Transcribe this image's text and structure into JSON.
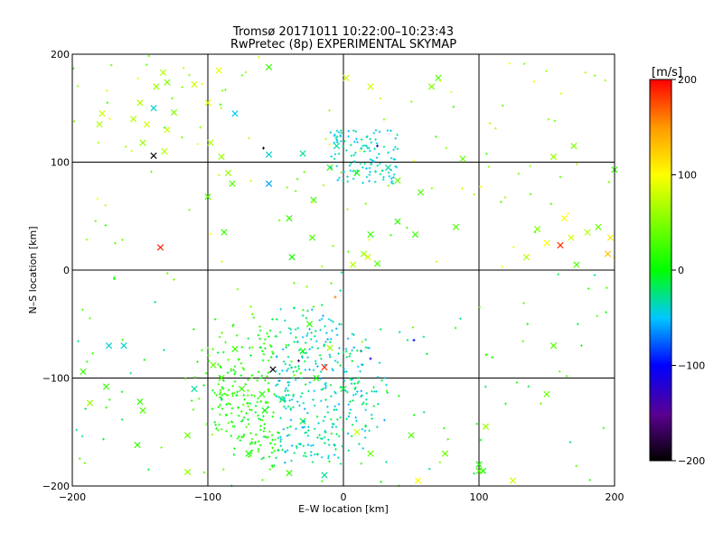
{
  "chart_data": {
    "type": "scatter",
    "title": "Tromsø 20171011 10:22:00–10:23:43",
    "subtitle": "RwPretec (8p) EXPERIMENTAL SKYMAP",
    "xlabel": "E–W location [km]",
    "ylabel": "N–S location [km]",
    "xlim": [
      -200,
      200
    ],
    "ylim": [
      -200,
      200
    ],
    "x_ticks": [
      "−200",
      "−100",
      "0",
      "100",
      "200"
    ],
    "y_ticks": [
      "−200",
      "−100",
      "0",
      "100",
      "200"
    ],
    "grid": true,
    "colorbar": {
      "label": "[m/s]",
      "range": [
        -200,
        200
      ],
      "ticks": [
        "200",
        "100",
        "0",
        "−100",
        "−200"
      ]
    },
    "marker_legend": "x = large marker, + = small marker",
    "points": [
      {
        "x": -140,
        "y": 106,
        "v": -200,
        "m": "x"
      },
      {
        "x": -135,
        "y": 21,
        "v": 190,
        "m": "x"
      },
      {
        "x": -52,
        "y": -92,
        "v": -200,
        "m": "x"
      },
      {
        "x": -14,
        "y": -90,
        "v": 190,
        "m": "x"
      },
      {
        "x": 160,
        "y": 23,
        "v": 185,
        "m": "x"
      },
      {
        "x": -59,
        "y": 113,
        "v": -200,
        "m": "+"
      },
      {
        "x": -33,
        "y": -84,
        "v": -170,
        "m": "+"
      },
      {
        "x": -6,
        "y": -25,
        "v": 160,
        "m": "+"
      },
      {
        "x": 20,
        "y": -82,
        "v": -110,
        "m": "+"
      },
      {
        "x": 52,
        "y": -65,
        "v": -100,
        "m": "+"
      },
      {
        "x": 13,
        "y": -75,
        "v": -110,
        "m": "+"
      },
      {
        "x": 25,
        "y": 115,
        "v": -110,
        "m": "+"
      },
      {
        "x": -55,
        "y": 80,
        "v": -60,
        "m": "x"
      },
      {
        "x": -80,
        "y": 145,
        "v": -50,
        "m": "x"
      },
      {
        "x": -140,
        "y": 150,
        "v": -40,
        "m": "x"
      },
      {
        "x": -173,
        "y": -70,
        "v": -40,
        "m": "x"
      },
      {
        "x": -162,
        "y": -70,
        "v": -40,
        "m": "x"
      },
      {
        "x": -110,
        "y": -110,
        "v": -30,
        "m": "x"
      },
      {
        "x": -14,
        "y": -190,
        "v": -30,
        "m": "x"
      },
      {
        "x": -55,
        "y": 107,
        "v": -40,
        "m": "x"
      },
      {
        "x": -30,
        "y": 108,
        "v": -30,
        "m": "x"
      },
      {
        "x": -5,
        "y": 115,
        "v": -30,
        "m": "x"
      },
      {
        "x": 33,
        "y": 95,
        "v": -30,
        "m": "x"
      },
      {
        "x": 100,
        "y": -180,
        "v": 10,
        "m": "x"
      },
      {
        "x": 103,
        "y": -186,
        "v": 10,
        "m": "x"
      },
      {
        "x": 105,
        "y": -145,
        "v": 60,
        "m": "x"
      },
      {
        "x": 88,
        "y": 103,
        "v": 40,
        "m": "x"
      },
      {
        "x": 70,
        "y": 178,
        "v": 30,
        "m": "x"
      },
      {
        "x": 65,
        "y": 170,
        "v": 50,
        "m": "x"
      },
      {
        "x": -55,
        "y": 188,
        "v": 20,
        "m": "x"
      },
      {
        "x": -92,
        "y": 185,
        "v": 90,
        "m": "x"
      },
      {
        "x": -98,
        "y": 118,
        "v": 70,
        "m": "x"
      },
      {
        "x": -90,
        "y": 105,
        "v": 60,
        "m": "x"
      },
      {
        "x": -82,
        "y": 80,
        "v": 30,
        "m": "x"
      },
      {
        "x": -85,
        "y": 90,
        "v": 60,
        "m": "x"
      },
      {
        "x": -100,
        "y": 68,
        "v": 30,
        "m": "x"
      },
      {
        "x": -88,
        "y": 35,
        "v": 20,
        "m": "x"
      },
      {
        "x": -40,
        "y": 48,
        "v": 20,
        "m": "x"
      },
      {
        "x": -23,
        "y": 30,
        "v": 30,
        "m": "x"
      },
      {
        "x": -38,
        "y": 12,
        "v": 10,
        "m": "x"
      },
      {
        "x": -22,
        "y": 65,
        "v": 20,
        "m": "x"
      },
      {
        "x": -10,
        "y": 95,
        "v": 20,
        "m": "x"
      },
      {
        "x": 10,
        "y": 90,
        "v": 10,
        "m": "x"
      },
      {
        "x": 40,
        "y": 83,
        "v": 40,
        "m": "x"
      },
      {
        "x": 57,
        "y": 72,
        "v": 30,
        "m": "x"
      },
      {
        "x": 40,
        "y": 45,
        "v": 20,
        "m": "x"
      },
      {
        "x": 53,
        "y": 33,
        "v": 20,
        "m": "x"
      },
      {
        "x": 83,
        "y": 40,
        "v": 30,
        "m": "x"
      },
      {
        "x": 20,
        "y": 33,
        "v": 20,
        "m": "x"
      },
      {
        "x": 15,
        "y": 15,
        "v": 60,
        "m": "x"
      },
      {
        "x": 18,
        "y": 12,
        "v": 80,
        "m": "x"
      },
      {
        "x": 7,
        "y": 5,
        "v": 70,
        "m": "x"
      },
      {
        "x": 25,
        "y": 6,
        "v": 30,
        "m": "x"
      },
      {
        "x": -100,
        "y": 155,
        "v": 90,
        "m": "x"
      },
      {
        "x": -150,
        "y": 155,
        "v": 70,
        "m": "x"
      },
      {
        "x": -145,
        "y": 135,
        "v": 80,
        "m": "x"
      },
      {
        "x": -155,
        "y": 140,
        "v": 70,
        "m": "x"
      },
      {
        "x": -132,
        "y": 110,
        "v": 70,
        "m": "x"
      },
      {
        "x": -125,
        "y": 146,
        "v": 50,
        "m": "x"
      },
      {
        "x": -130,
        "y": 130,
        "v": 80,
        "m": "x"
      },
      {
        "x": -148,
        "y": 118,
        "v": 60,
        "m": "x"
      },
      {
        "x": -178,
        "y": 145,
        "v": 80,
        "m": "x"
      },
      {
        "x": -180,
        "y": 135,
        "v": 70,
        "m": "x"
      },
      {
        "x": -133,
        "y": 183,
        "v": 70,
        "m": "x"
      },
      {
        "x": -130,
        "y": 174,
        "v": 50,
        "m": "x"
      },
      {
        "x": -138,
        "y": 170,
        "v": 60,
        "m": "x"
      },
      {
        "x": -110,
        "y": 172,
        "v": 80,
        "m": "x"
      },
      {
        "x": 20,
        "y": 170,
        "v": 80,
        "m": "x"
      },
      {
        "x": 2,
        "y": 178,
        "v": 80,
        "m": "x"
      },
      {
        "x": 155,
        "y": 105,
        "v": 60,
        "m": "x"
      },
      {
        "x": 170,
        "y": 115,
        "v": 50,
        "m": "x"
      },
      {
        "x": 135,
        "y": 12,
        "v": 70,
        "m": "x"
      },
      {
        "x": 143,
        "y": 38,
        "v": 50,
        "m": "x"
      },
      {
        "x": 163,
        "y": 48,
        "v": 100,
        "m": "x"
      },
      {
        "x": 168,
        "y": 30,
        "v": 80,
        "m": "x"
      },
      {
        "x": 172,
        "y": 5,
        "v": 30,
        "m": "x"
      },
      {
        "x": 188,
        "y": 40,
        "v": 40,
        "m": "x"
      },
      {
        "x": 197,
        "y": 30,
        "v": 110,
        "m": "x"
      },
      {
        "x": 195,
        "y": 15,
        "v": 130,
        "m": "x"
      },
      {
        "x": 150,
        "y": 25,
        "v": 100,
        "m": "x"
      },
      {
        "x": 180,
        "y": 35,
        "v": 70,
        "m": "x"
      },
      {
        "x": 200,
        "y": 93,
        "v": 20,
        "m": "x"
      },
      {
        "x": -192,
        "y": -94,
        "v": 20,
        "m": "x"
      },
      {
        "x": -175,
        "y": -108,
        "v": 20,
        "m": "x"
      },
      {
        "x": -187,
        "y": -123,
        "v": 60,
        "m": "x"
      },
      {
        "x": -150,
        "y": -122,
        "v": 20,
        "m": "x"
      },
      {
        "x": -148,
        "y": -130,
        "v": 30,
        "m": "x"
      },
      {
        "x": -152,
        "y": -162,
        "v": 20,
        "m": "x"
      },
      {
        "x": -115,
        "y": -153,
        "v": 40,
        "m": "x"
      },
      {
        "x": -115,
        "y": -187,
        "v": 60,
        "m": "x"
      },
      {
        "x": -96,
        "y": -88,
        "v": 40,
        "m": "x"
      },
      {
        "x": -90,
        "y": -100,
        "v": 30,
        "m": "x"
      },
      {
        "x": -80,
        "y": -73,
        "v": 20,
        "m": "x"
      },
      {
        "x": -75,
        "y": -110,
        "v": 20,
        "m": "x"
      },
      {
        "x": -60,
        "y": -115,
        "v": 10,
        "m": "x"
      },
      {
        "x": -25,
        "y": -50,
        "v": 20,
        "m": "x"
      },
      {
        "x": -10,
        "y": -72,
        "v": 60,
        "m": "x"
      },
      {
        "x": 0,
        "y": -110,
        "v": -10,
        "m": "x"
      },
      {
        "x": 10,
        "y": -150,
        "v": 80,
        "m": "x"
      },
      {
        "x": 20,
        "y": -170,
        "v": 40,
        "m": "x"
      },
      {
        "x": 50,
        "y": -153,
        "v": 30,
        "m": "x"
      },
      {
        "x": 55,
        "y": -195,
        "v": 100,
        "m": "x"
      },
      {
        "x": 75,
        "y": -170,
        "v": 40,
        "m": "x"
      },
      {
        "x": 100,
        "y": -186,
        "v": 30,
        "m": "x"
      },
      {
        "x": 125,
        "y": -195,
        "v": 80,
        "m": "x"
      },
      {
        "x": 150,
        "y": -115,
        "v": 40,
        "m": "x"
      },
      {
        "x": 155,
        "y": -70,
        "v": 30,
        "m": "x"
      },
      {
        "x": -40,
        "y": -188,
        "v": 20,
        "m": "x"
      },
      {
        "x": -70,
        "y": -170,
        "v": 10,
        "m": "x"
      },
      {
        "x": -30,
        "y": -140,
        "v": -10,
        "m": "x"
      },
      {
        "x": -45,
        "y": -120,
        "v": -10,
        "m": "x"
      },
      {
        "x": -58,
        "y": -130,
        "v": 0,
        "m": "x"
      },
      {
        "x": -20,
        "y": -100,
        "v": 0,
        "m": "x"
      },
      {
        "x": -30,
        "y": -75,
        "v": 0,
        "m": "x"
      }
    ]
  }
}
